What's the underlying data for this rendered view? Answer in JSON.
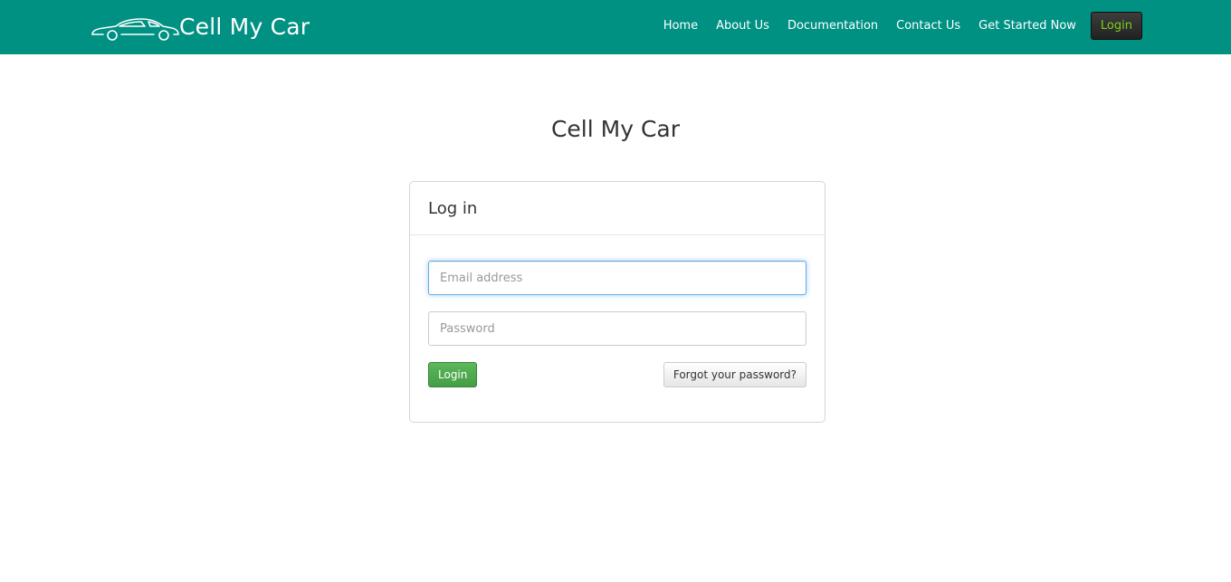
{
  "navbar": {
    "brand_logo_icon": "car-icon",
    "brand_name": "Cell My Car",
    "links": [
      "Home",
      "About Us",
      "Documentation",
      "Contact Us",
      "Get Started Now"
    ],
    "login_label": "Login",
    "background_color": "#009183",
    "login_text_color": "#7dd11f"
  },
  "main": {
    "heading": "Cell My Car",
    "card": {
      "title": "Log in",
      "email_placeholder": "Email address",
      "password_placeholder": "Password",
      "login_button": "Login",
      "forgot_button": "Forgot your password?"
    }
  }
}
